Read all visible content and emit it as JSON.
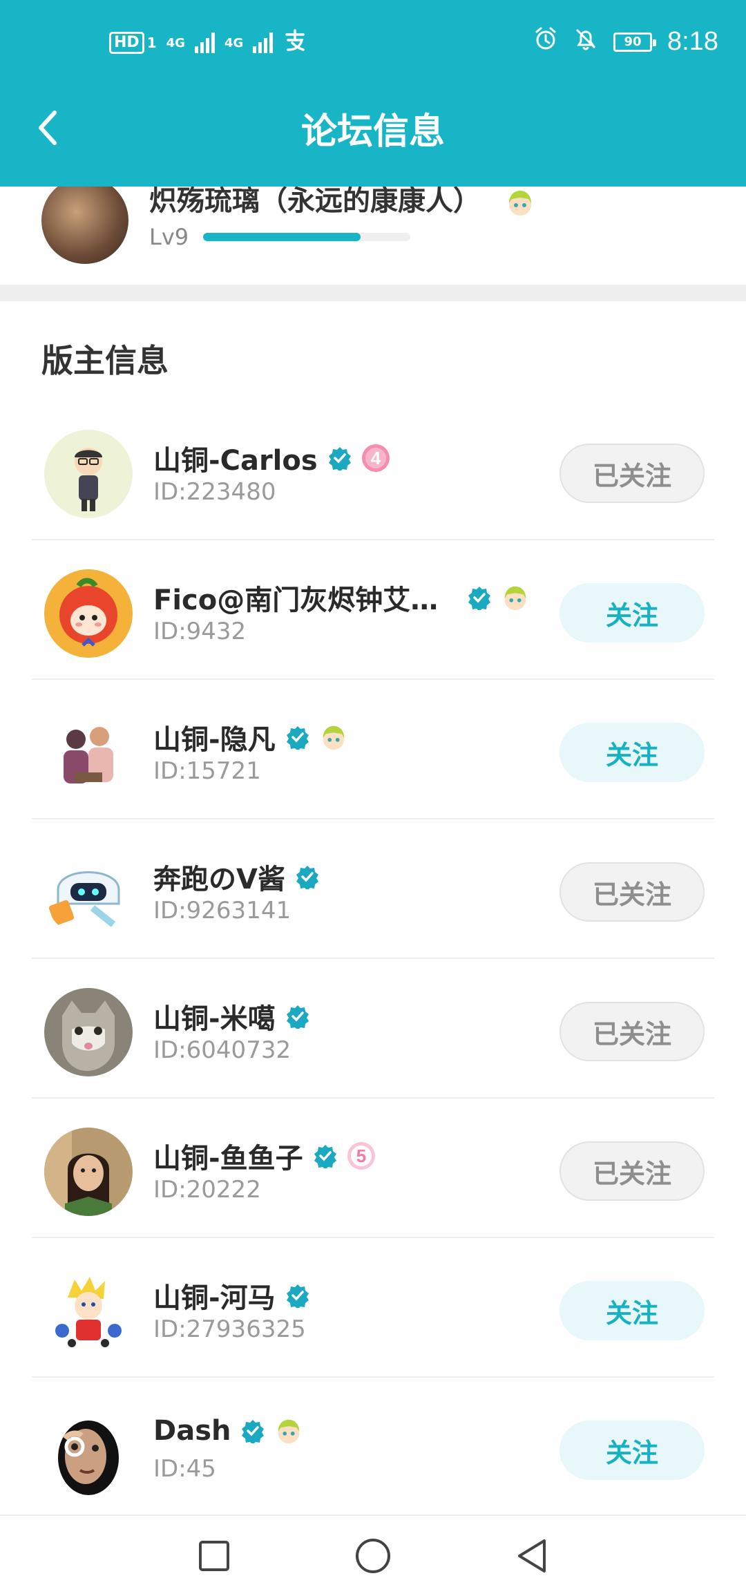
{
  "status_bar": {
    "left_indicators": [
      "HD",
      "1",
      "4G",
      "4G"
    ],
    "battery": "90",
    "time": "8:18"
  },
  "header": {
    "title": "论坛信息",
    "back_icon": "chevron-left-icon",
    "background_color": "#18b5c6"
  },
  "level_card": {
    "name": "炽殇琉璃（永远的康康人）",
    "level": "Lv9",
    "progress": 0.76
  },
  "section": {
    "title": "版主信息"
  },
  "moderators": [
    {
      "name": "山铜-Carlos",
      "id": "ID:223480",
      "button": "已关注",
      "followed": true,
      "badge": "level-4-badge"
    },
    {
      "name": "Fico@南门灰烬钟艾莉...",
      "id": "ID:9432",
      "button": "关注",
      "followed": false,
      "badge": "anime-girl-badge"
    },
    {
      "name": "山铜-隐凡",
      "id": "ID:15721",
      "button": "关注",
      "followed": false,
      "badge": "anime-girl-badge"
    },
    {
      "name": "奔跑のV酱",
      "id": "ID:9263141",
      "button": "已关注",
      "followed": true,
      "badge": ""
    },
    {
      "name": "山铜-米噶",
      "id": "ID:6040732",
      "button": "已关注",
      "followed": true,
      "badge": ""
    },
    {
      "name": "山铜-鱼鱼子",
      "id": "ID:20222",
      "button": "已关注",
      "followed": true,
      "badge": "level-5-badge"
    },
    {
      "name": "山铜-河马",
      "id": "ID:27936325",
      "button": "关注",
      "followed": false,
      "badge": ""
    },
    {
      "name": "Dash",
      "id": "ID:45",
      "button": "关注",
      "followed": false,
      "badge": "anime-girl-badge"
    }
  ],
  "colors": {
    "accent": "#18b5c6",
    "verified": "#1aa9c0",
    "followed_bg": "#f2f2f2",
    "follow_bg": "#e8f7f9"
  }
}
